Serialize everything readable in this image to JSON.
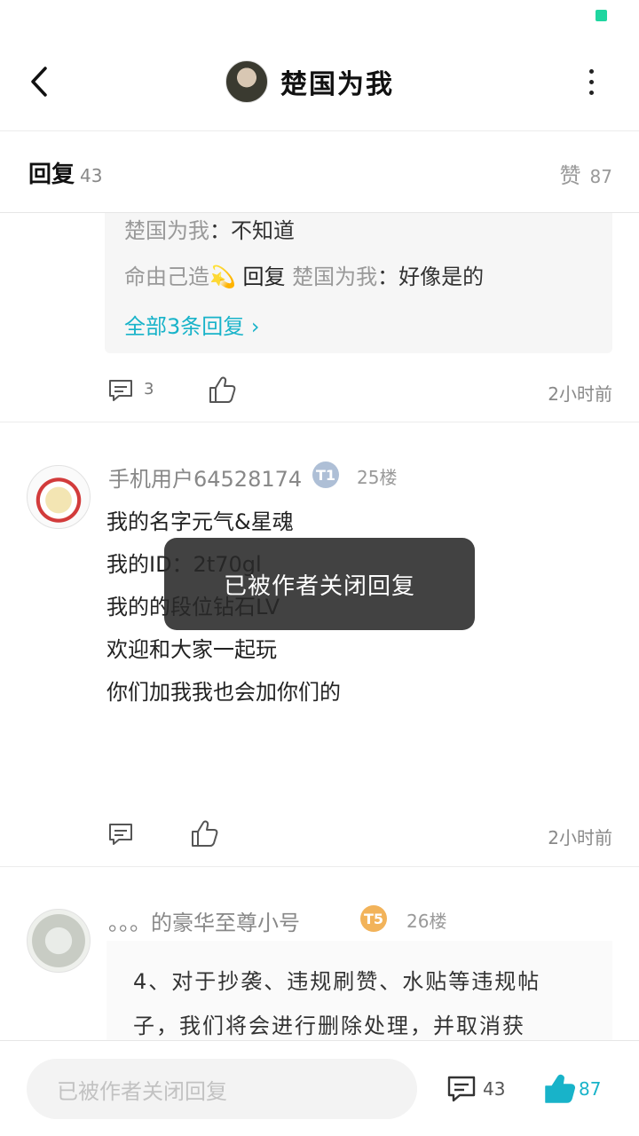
{
  "header": {
    "title": "楚国为我"
  },
  "tabs": {
    "reply_label": "回复",
    "reply_count": "43",
    "likes_label": "赞",
    "likes_count": "87"
  },
  "subreplies": {
    "line1_name": "楚国为我",
    "line1_text": "：不知道",
    "line2_name": "命由己造💫",
    "line2_reply_word": " 回复 ",
    "line2_target": "楚国为我",
    "line2_text": "：好像是的",
    "all_link": "全部3条回复 ›"
  },
  "top_actions": {
    "comment_count": "3",
    "time": "2小时前"
  },
  "post1": {
    "username": "手机用户64528174",
    "badge": "T1",
    "floor": "25楼",
    "lines": [
      "我的名字元气&星魂",
      "我的ID：2t70gl",
      "我的的段位钻石LV",
      "欢迎和大家一起玩",
      "你们加我我也会加你们的"
    ],
    "time": "2小时前"
  },
  "post2": {
    "username": "。。。的豪华至尊小号",
    "badge": "T5",
    "floor": "26楼",
    "quote_lines": [
      "4、对于抄袭、违规刷赞、水贴等违规帖",
      "子，我们将会进行删除处理，并取消获"
    ]
  },
  "toast": {
    "text": "已被作者关闭回复"
  },
  "bottom": {
    "input_placeholder": "已被作者关闭回复",
    "comment_count": "43",
    "like_count": "87"
  },
  "colors": {
    "accent": "#18b3c9",
    "status": "#1fd6a0"
  }
}
